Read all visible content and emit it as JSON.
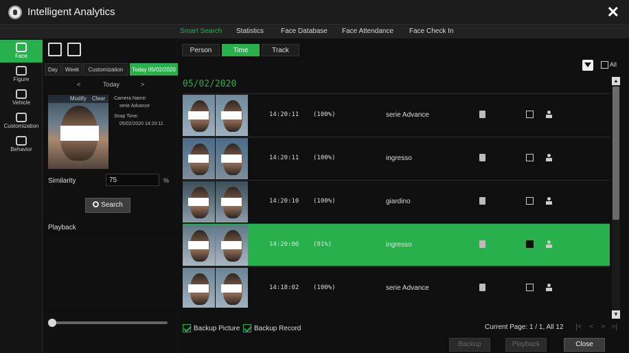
{
  "window": {
    "title": "Intelligent Analytics"
  },
  "top_nav": [
    {
      "label": "Smart Search",
      "active": true
    },
    {
      "label": "Statistics",
      "active": false
    },
    {
      "label": "Face Database",
      "active": false
    },
    {
      "label": "Face Attendance",
      "active": false
    },
    {
      "label": "Face Check In",
      "active": false
    }
  ],
  "categories": [
    {
      "label": "Face",
      "icon": "face-icon",
      "active": true
    },
    {
      "label": "Figure",
      "icon": "figure-icon",
      "active": false
    },
    {
      "label": "Vehicle",
      "icon": "vehicle-icon",
      "active": false
    },
    {
      "label": "Customization",
      "icon": "customization-icon",
      "active": false
    },
    {
      "label": "Behavior",
      "icon": "behavior-icon",
      "active": false
    }
  ],
  "date_tabs": [
    {
      "label": "Day",
      "active": false
    },
    {
      "label": "Week",
      "active": false
    },
    {
      "label": "Customization",
      "active": false
    },
    {
      "label": "Today 05/02/2020",
      "active": true
    }
  ],
  "day_nav": {
    "prev": "<",
    "label": "Today",
    "next": ">"
  },
  "snapshot": {
    "modify": "Modify",
    "clear": "Clear",
    "camera_name_label": "Camera Name:",
    "camera_name": "serie Advance",
    "snap_time_label": "Snap Time:",
    "snap_time": "05/02/2020 14:20:11"
  },
  "similarity": {
    "label": "Similarity",
    "value": "75",
    "unit": "%"
  },
  "search_button": "Search",
  "playback_label": "Playback",
  "playback_slider_fraction": 0.0,
  "result_tabs": [
    {
      "label": "Person",
      "active": false
    },
    {
      "label": "Time",
      "active": true
    },
    {
      "label": "Track",
      "active": false
    }
  ],
  "all_label": "All",
  "date_heading": "05/02/2020",
  "results": [
    {
      "time": "14:20:11",
      "score": "(100%)",
      "camera": "serie Advance",
      "selected": false
    },
    {
      "time": "14:20:11",
      "score": "(100%)",
      "camera": "ingresso",
      "selected": false
    },
    {
      "time": "14:20:10",
      "score": "(100%)",
      "camera": "giardino",
      "selected": false
    },
    {
      "time": "14:20:06",
      "score": "(91%)",
      "camera": "ingresso",
      "selected": true
    },
    {
      "time": "14:18:02",
      "score": "(100%)",
      "camera": "serie Advance",
      "selected": false
    }
  ],
  "bottom": {
    "backup_picture": "Backup Picture",
    "backup_record": "Backup Record",
    "page_info": "Current Page: 1 / 1, All 12",
    "pager": [
      "|<",
      "<",
      ">",
      ">|"
    ],
    "backup_btn": "Backup",
    "playback_btn": "Playback",
    "close_btn": "Close"
  },
  "colors": {
    "accent": "#27b04c",
    "background": "#0f0f0f"
  }
}
